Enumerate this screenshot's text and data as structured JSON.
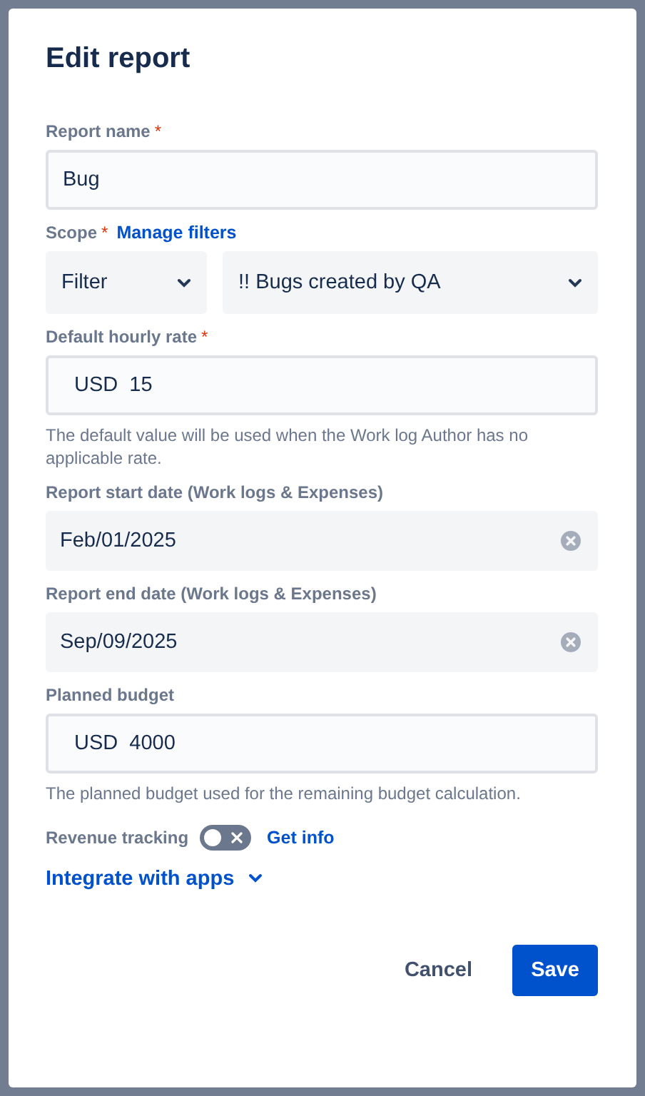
{
  "dialog": {
    "title": "Edit report"
  },
  "fields": [
    {
      "kind": "text",
      "label": "Report name",
      "required_mark": "*",
      "value": "Bug"
    },
    {
      "kind": "scope",
      "label": "Scope",
      "required_mark": "*",
      "link": "Manage filters",
      "selects": [
        {
          "value": "Filter"
        },
        {
          "value": "!! Bugs created by QA"
        }
      ]
    },
    {
      "kind": "money",
      "label": "Default hourly rate",
      "required_mark": "*",
      "currency": "USD",
      "value": "15",
      "help": "The default value will be used when the Work log Author has no applicable rate."
    },
    {
      "kind": "date",
      "label": "Report start date (Work logs & Expenses)",
      "value": "Feb/01/2025"
    },
    {
      "kind": "date",
      "label": "Report end date (Work logs & Expenses)",
      "value": "Sep/09/2025"
    },
    {
      "kind": "money",
      "label": "Planned budget",
      "currency": "USD",
      "value": "4000",
      "help": "The planned budget used for the remaining budget calculation."
    }
  ],
  "revenue_tracking": {
    "label": "Revenue tracking",
    "on": false,
    "link": "Get info"
  },
  "integrate": {
    "label": "Integrate with apps",
    "expanded": false
  },
  "buttons": {
    "cancel": "Cancel",
    "save": "Save"
  }
}
